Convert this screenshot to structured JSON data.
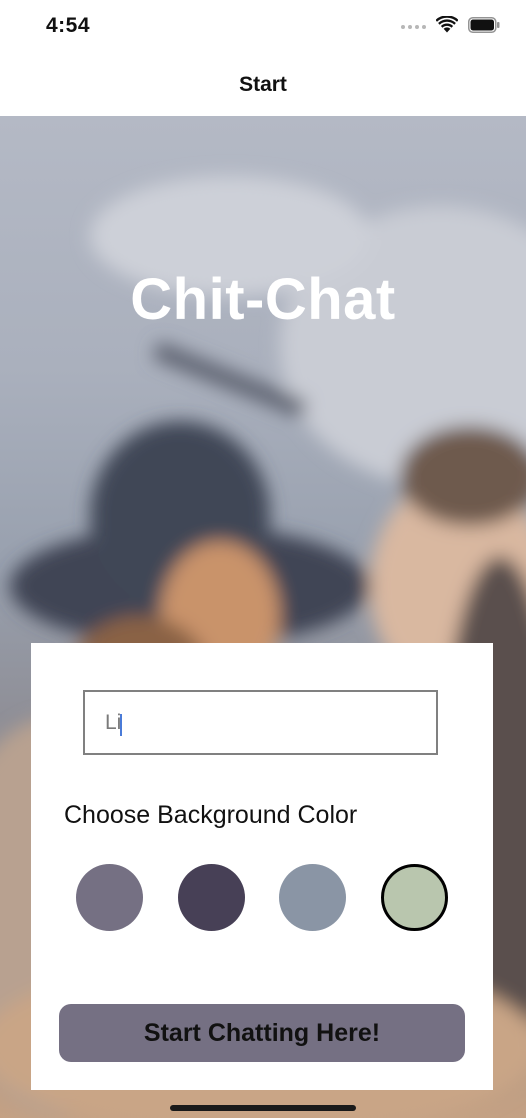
{
  "status_bar": {
    "time": "4:54",
    "wifi_icon": "wifi-icon",
    "battery_icon": "battery-icon"
  },
  "nav": {
    "title": "Start"
  },
  "hero": {
    "app_title": "Chit-Chat"
  },
  "form": {
    "name_value": "Li",
    "choose_label": "Choose Background Color",
    "colors": [
      "#757083",
      "#474056",
      "#8A95A5",
      "#B9C6AE"
    ],
    "selected_color_index": 3,
    "start_button_label": "Start Chatting Here!",
    "start_button_color": "#757083"
  }
}
